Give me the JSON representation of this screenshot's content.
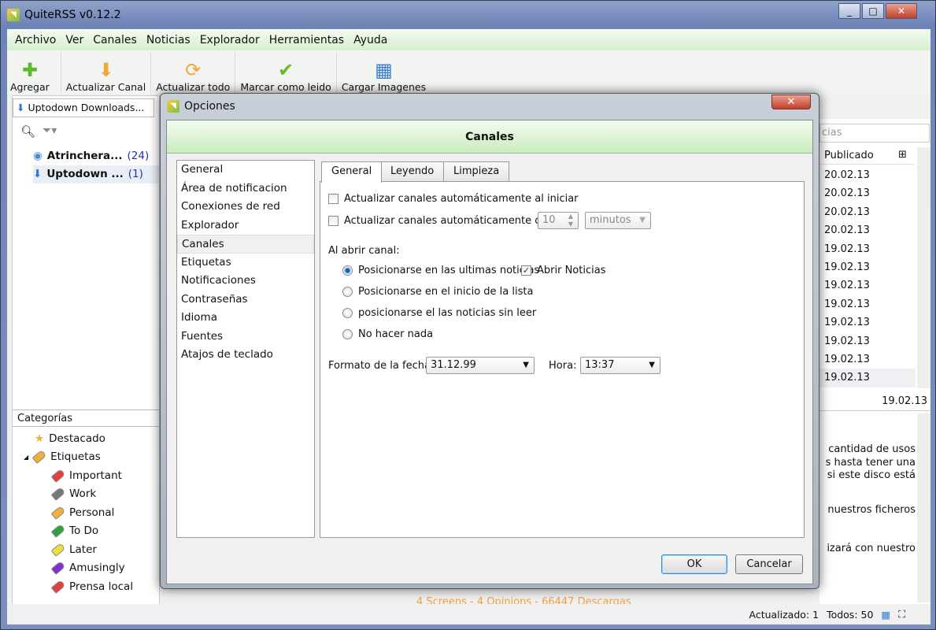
{
  "window": {
    "title": "QuiteRSS v0.12.2",
    "controls": [
      "_",
      "□",
      "✕"
    ]
  },
  "menu": [
    "Archivo",
    "Ver",
    "Canales",
    "Noticias",
    "Explorador",
    "Herramientas",
    "Ayuda"
  ],
  "toolbar": [
    {
      "label": "Agregar",
      "icon": "plus-icon",
      "glyph": "✚",
      "color": "#5fb82b"
    },
    {
      "label": "Actualizar Canal",
      "icon": "arrow-down-icon",
      "glyph": "⬇",
      "color": "#f4a53a"
    },
    {
      "label": "Actualizar todo",
      "icon": "refresh-icon",
      "glyph": "⟳",
      "color": "#f4a53a"
    },
    {
      "label": "Marcar como leido",
      "icon": "checkmark-icon",
      "glyph": "✔",
      "color": "#6ab82b"
    },
    {
      "label": "Cargar Imagenes",
      "icon": "images-icon",
      "glyph": "▦",
      "color": "#3a7fd0"
    }
  ],
  "left": {
    "tab": "Uptodown Downloads...",
    "feeds": [
      {
        "name": "Atrinchera...",
        "count": "(24)"
      },
      {
        "name": "Uptodown ...",
        "count": "(1)"
      }
    ],
    "categories_header": "Categorías",
    "categories": [
      {
        "label": "Destacado"
      },
      {
        "label": "Etiquetas"
      }
    ],
    "tags": [
      {
        "label": "Important",
        "color": "#e04040"
      },
      {
        "label": "Work",
        "color": "#777777"
      },
      {
        "label": "Personal",
        "color": "#f0b040"
      },
      {
        "label": "To Do",
        "color": "#30a040"
      },
      {
        "label": "Later",
        "color": "#e8e040"
      },
      {
        "label": "Amusingly",
        "color": "#8030d0"
      },
      {
        "label": "Prensa local",
        "color": "#e04040"
      }
    ]
  },
  "right": {
    "search_partial": "cias",
    "column": "Publicado",
    "dates": [
      "20.02.13",
      "20.02.13",
      "20.02.13",
      "20.02.13",
      "19.02.13",
      "19.02.13",
      "19.02.13",
      "19.02.13",
      "19.02.13",
      "19.02.13",
      "19.02.13",
      "19.02.13"
    ],
    "detail_date": "19.02.13",
    "content": [
      "cantidad de usos",
      "s hasta tener una",
      "si este disco está",
      "nuestros ficheros",
      "izará con nuestro"
    ],
    "footer_partial": "4 Screens - 4 Opinions - 66447 Descargas"
  },
  "status": {
    "updated": "Actualizado: 1",
    "total": "Todos: 50"
  },
  "dialog": {
    "title": "Opciones",
    "header": "Canales",
    "categories": [
      "General",
      "Área de notificacion",
      "Conexiones de red",
      "Explorador",
      "Canales",
      "Etiquetas",
      "Notificaciones",
      "Contraseñas",
      "Idioma",
      "Fuentes",
      "Atajos de teclado"
    ],
    "selected": "Canales",
    "tabs": [
      "General",
      "Leyendo",
      "Limpieza"
    ],
    "opt_start": "Actualizar canales automáticamente al iniciar",
    "opt_every": "Actualizar canales automáticamente cada",
    "interval_value": "10",
    "interval_unit": "minutos",
    "open_label": "Al abrir canal:",
    "radios": [
      "Posicionarse en las ultimas noticias",
      "Posicionarse en el inicio de la lista",
      "posicionarse el las noticias sin leer",
      "No hacer nada"
    ],
    "open_news": "Abrir Noticias",
    "date_label": "Formato de la fecha:",
    "date_value": "31.12.99",
    "time_label": "Hora:",
    "time_value": "13:37",
    "ok": "OK",
    "cancel": "Cancelar"
  }
}
